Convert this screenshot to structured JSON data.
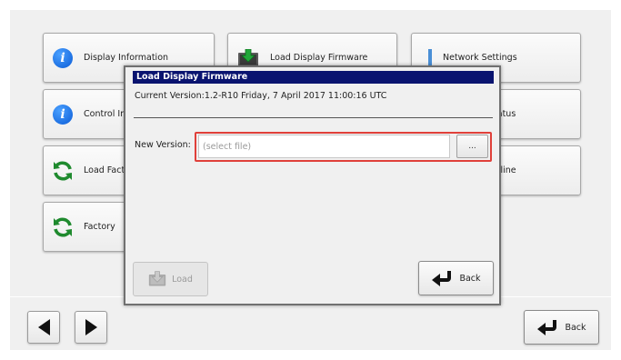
{
  "tiles": {
    "display_info": "Display Information",
    "load_display_firmware": "Load Display Firmware",
    "network_settings": "Network Settings",
    "control_info": "Control Information",
    "status": "Status",
    "load_factory": "Load Factory",
    "online": "Online",
    "factory": "Factory"
  },
  "nav": {
    "back_label": "Back"
  },
  "dialog": {
    "title": "Load Display Firmware",
    "current_version": "Current Version:1.2-R10  Friday, 7 April 2017 11:00:16 UTC",
    "new_version_label": "New Version:",
    "file_placeholder": "(select file)",
    "browse_label": "...",
    "load_label": "Load",
    "back_label": "Back"
  },
  "icons": {
    "info": "info-icon",
    "refresh": "refresh-icon",
    "download": "download-icon",
    "network": "network-icon",
    "back": "back-arrow-icon",
    "prev": "left-arrow-icon",
    "next": "right-arrow-icon"
  },
  "colors": {
    "title_bar": "#0a1470",
    "highlight": "#e0403a",
    "info_icon": "#0b5cd6",
    "refresh_icon": "#1f8a2e"
  }
}
